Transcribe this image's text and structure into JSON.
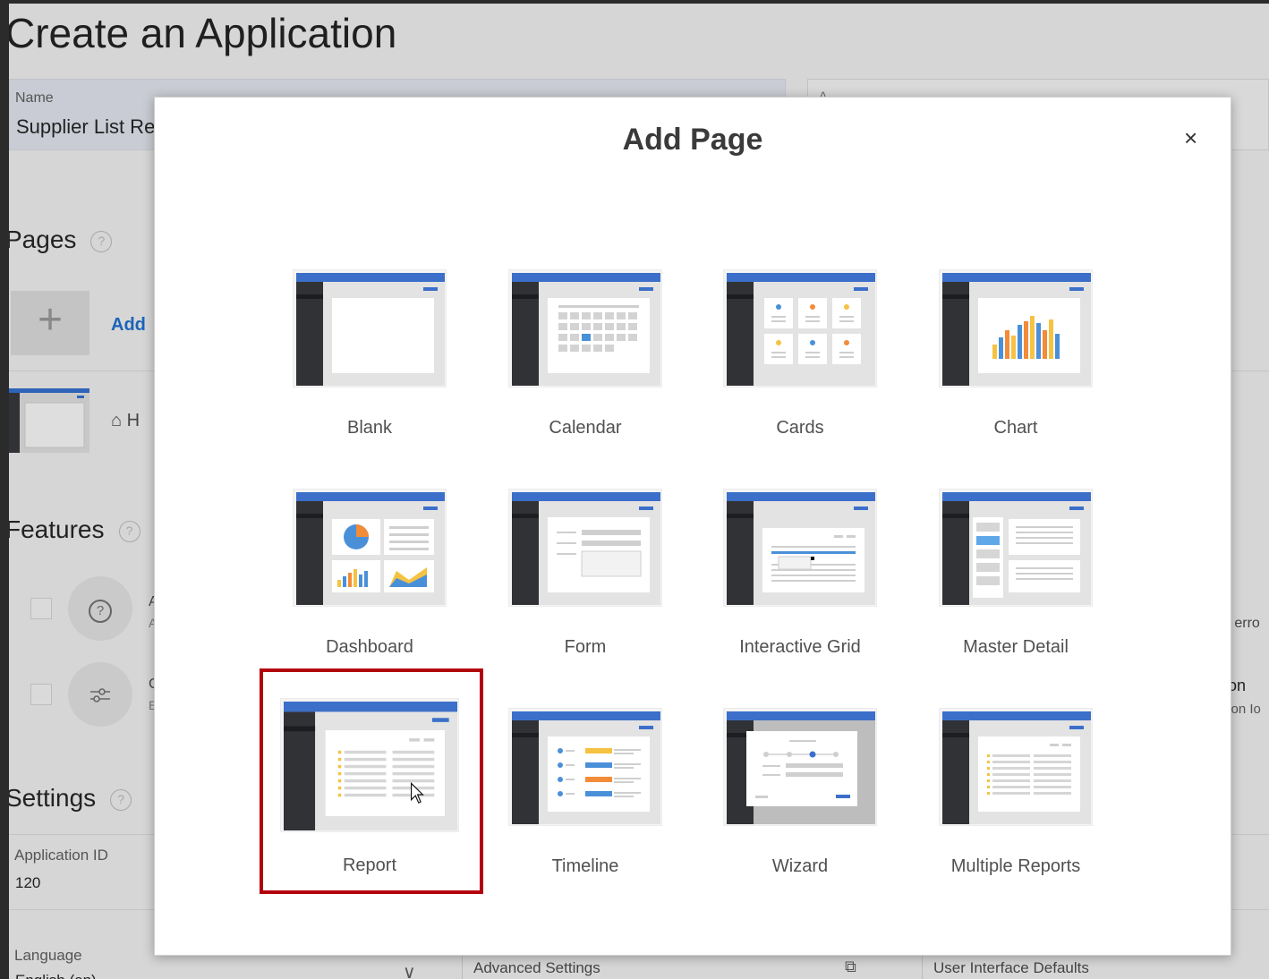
{
  "background": {
    "title": "Create an Application",
    "name_field": {
      "label": "Name",
      "value": "Supplier List Re"
    },
    "right_field": {
      "label": "A"
    },
    "pages": {
      "heading": "Pages",
      "help_icon": "?",
      "add_icon": "+",
      "add_label": "Add",
      "home_label": "H"
    },
    "features": {
      "heading": "Features",
      "help_icon": "?",
      "item1_letters": [
        "A",
        "A"
      ],
      "item2_letters": [
        "C",
        "E"
      ],
      "right_text1": "d erro",
      "right_text2a": "on",
      "right_text2b": "tion Io"
    },
    "settings": {
      "heading": "Settings",
      "help_icon": "?",
      "app_id_label": "Application ID",
      "app_id_value": "120",
      "language_label": "Language",
      "language_value": "English (en)"
    },
    "bottom": {
      "advanced_settings": "Advanced Settings",
      "user_interface_defaults": "User Interface Defaults"
    }
  },
  "modal": {
    "title": "Add Page",
    "close_icon": "×",
    "tiles": [
      {
        "label": "Blank",
        "icon": "blank-page-icon"
      },
      {
        "label": "Calendar",
        "icon": "calendar-page-icon"
      },
      {
        "label": "Cards",
        "icon": "cards-page-icon"
      },
      {
        "label": "Chart",
        "icon": "chart-page-icon"
      },
      {
        "label": "Dashboard",
        "icon": "dashboard-page-icon"
      },
      {
        "label": "Form",
        "icon": "form-page-icon"
      },
      {
        "label": "Interactive Grid",
        "icon": "interactive-grid-page-icon"
      },
      {
        "label": "Master Detail",
        "icon": "master-detail-page-icon"
      },
      {
        "label": "Report",
        "icon": "report-page-icon",
        "selected": true
      },
      {
        "label": "Timeline",
        "icon": "timeline-page-icon"
      },
      {
        "label": "Wizard",
        "icon": "wizard-page-icon"
      },
      {
        "label": "Multiple Reports",
        "icon": "multiple-reports-page-icon"
      }
    ]
  },
  "colors": {
    "accent_blue": "#3b6fc9",
    "dark_sidebar": "#303236",
    "highlight_red": "#b3000d",
    "link_blue": "#1b64b8"
  }
}
